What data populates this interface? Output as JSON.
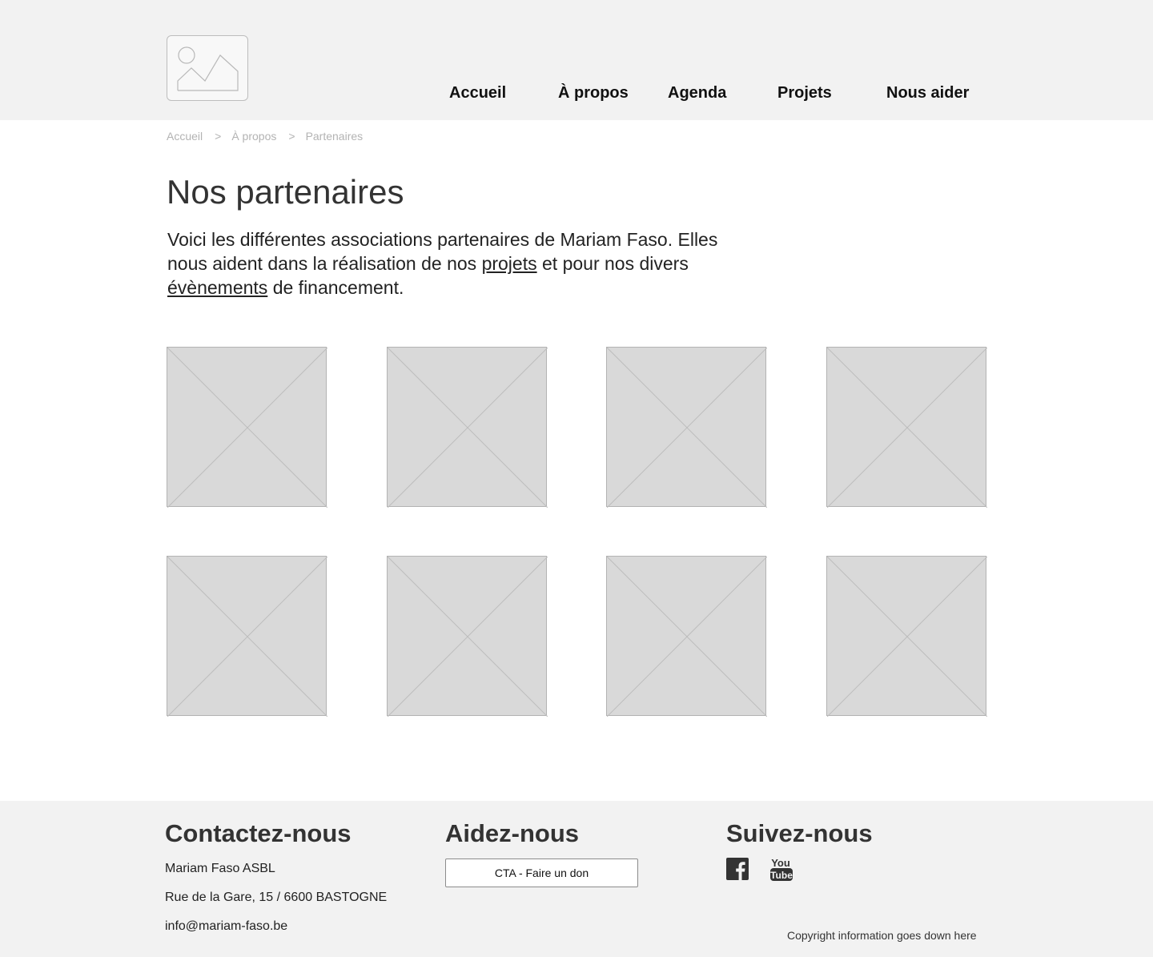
{
  "header": {
    "nav": [
      {
        "label": "Accueil"
      },
      {
        "label": "À propos"
      },
      {
        "label": "Agenda"
      },
      {
        "label": "Projets"
      },
      {
        "label": "Nous aider"
      }
    ]
  },
  "breadcrumb": {
    "items": [
      "Accueil",
      "À propos",
      "Partenaires"
    ],
    "separator": ">"
  },
  "main": {
    "title": "Nos partenaires",
    "intro": {
      "part1": "Voici les différentes associations partenaires de Mariam Faso. Elles nous aident dans la réalisation de nos ",
      "link1": "projets",
      "part2": " et pour nos divers ",
      "link2": "évènements",
      "part3": " de financement."
    },
    "partners_count": 8
  },
  "footer": {
    "contact": {
      "heading": "Contactez-nous",
      "name": "Mariam Faso ASBL",
      "address": "Rue de la Gare, 15 / 6600 BASTOGNE",
      "email": "info@mariam-faso.be"
    },
    "help": {
      "heading": "Aidez-nous",
      "cta_label": "CTA - Faire un don"
    },
    "follow": {
      "heading": "Suivez-nous",
      "icons": [
        "facebook-icon",
        "youtube-icon"
      ]
    },
    "copyright": "Copyright information goes down here"
  },
  "colors": {
    "header_bg": "#f2f2f2",
    "footer_bg": "#f2f2f2",
    "placeholder_fill": "#d9d9d9",
    "placeholder_border": "#b3b3b3",
    "text": "#333333",
    "breadcrumb": "#b3b3b3"
  }
}
